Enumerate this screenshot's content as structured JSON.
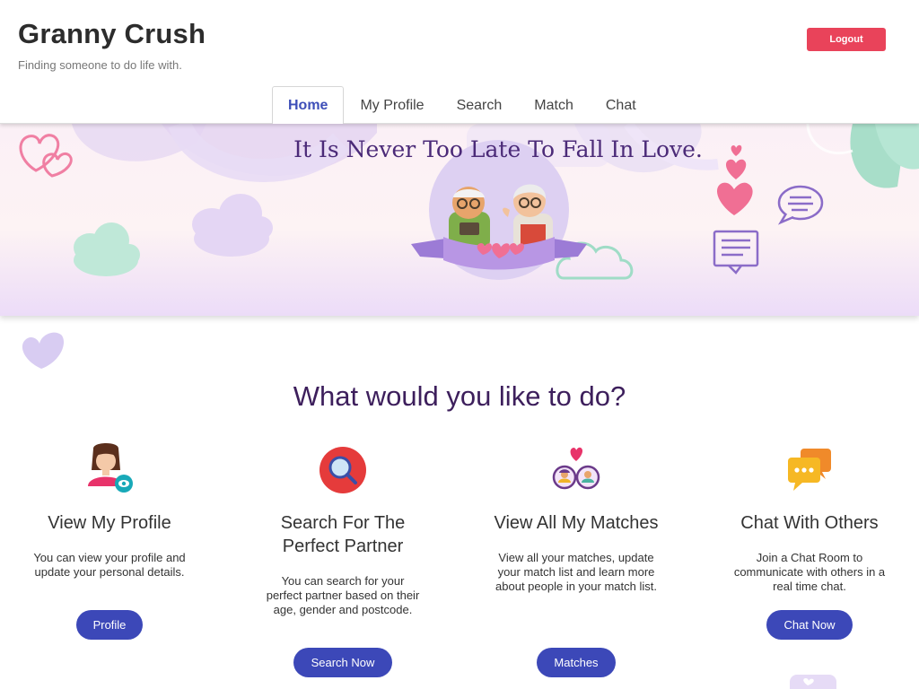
{
  "app": {
    "title": "Granny Crush",
    "tagline": "Finding someone to do life with."
  },
  "header": {
    "logout_label": "Logout"
  },
  "nav": {
    "tabs": [
      {
        "label": "Home",
        "active": true
      },
      {
        "label": "My Profile",
        "active": false
      },
      {
        "label": "Search",
        "active": false
      },
      {
        "label": "Match",
        "active": false
      },
      {
        "label": "Chat",
        "active": false
      }
    ]
  },
  "banner": {
    "headline": "It Is Never Too Late To Fall In Love."
  },
  "main": {
    "heading": "What would you like to do?",
    "features": [
      {
        "icon": "profile-icon",
        "title": "View My Profile",
        "description": "You can view your profile and update your personal details.",
        "button_label": "Profile"
      },
      {
        "icon": "search-icon",
        "title": "Search For The Perfect Partner",
        "description": "You can search for your perfect partner based on their age, gender and postcode.",
        "button_label": "Search Now"
      },
      {
        "icon": "matches-icon",
        "title": "View All My Matches",
        "description": "View all your matches, update your match list and learn more about people in your match list.",
        "button_label": "Matches"
      },
      {
        "icon": "chat-icon",
        "title": "Chat With Others",
        "description": "Join a Chat Room to communicate with others in a real time chat.",
        "button_label": "Chat Now"
      }
    ]
  },
  "colors": {
    "accent": "#3c48b8",
    "logout": "#e9435a",
    "heading": "#3d1f5c",
    "banner_text": "#4b2a78"
  }
}
